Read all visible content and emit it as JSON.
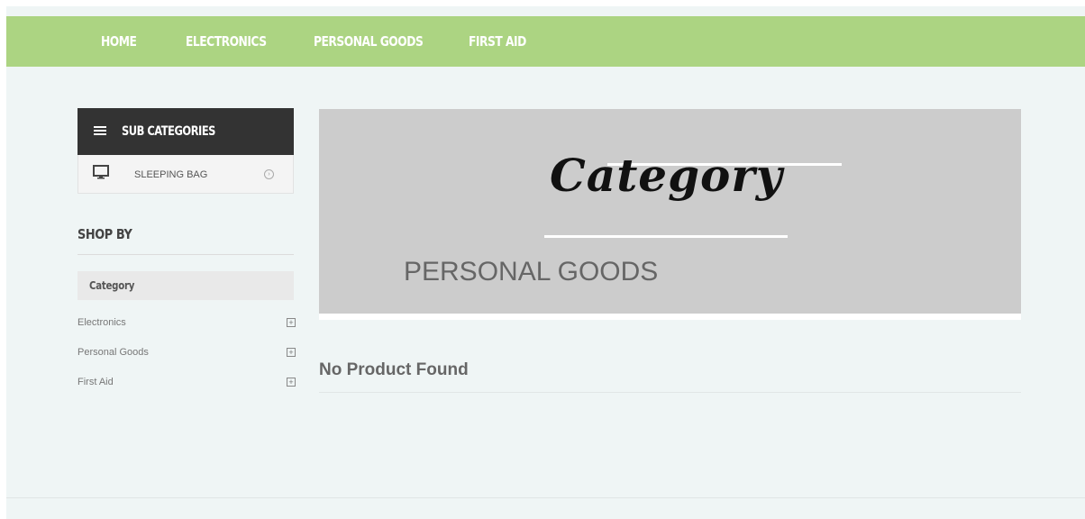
{
  "nav": {
    "items": [
      {
        "label": "HOME"
      },
      {
        "label": "ELECTRONICS"
      },
      {
        "label": "PERSONAL GOODS"
      },
      {
        "label": "FIRST AID"
      }
    ],
    "bar_color": "#acd482"
  },
  "sidebar": {
    "subcategories": {
      "title": "SUB CATEGORIES",
      "icon": "menu-icon",
      "items": [
        {
          "label": "SLEEPING BAG",
          "icon": "monitor-icon"
        }
      ]
    },
    "shop_by": {
      "title": "SHOP BY",
      "filter_title": "Category",
      "filters": [
        {
          "label": "Electronics"
        },
        {
          "label": "Personal Goods"
        },
        {
          "label": "First Aid"
        }
      ]
    }
  },
  "main": {
    "banner": {
      "script_text": "Category",
      "title": "PERSONAL GOODS",
      "background": "#cccccc"
    },
    "empty_message": "No Product Found"
  }
}
